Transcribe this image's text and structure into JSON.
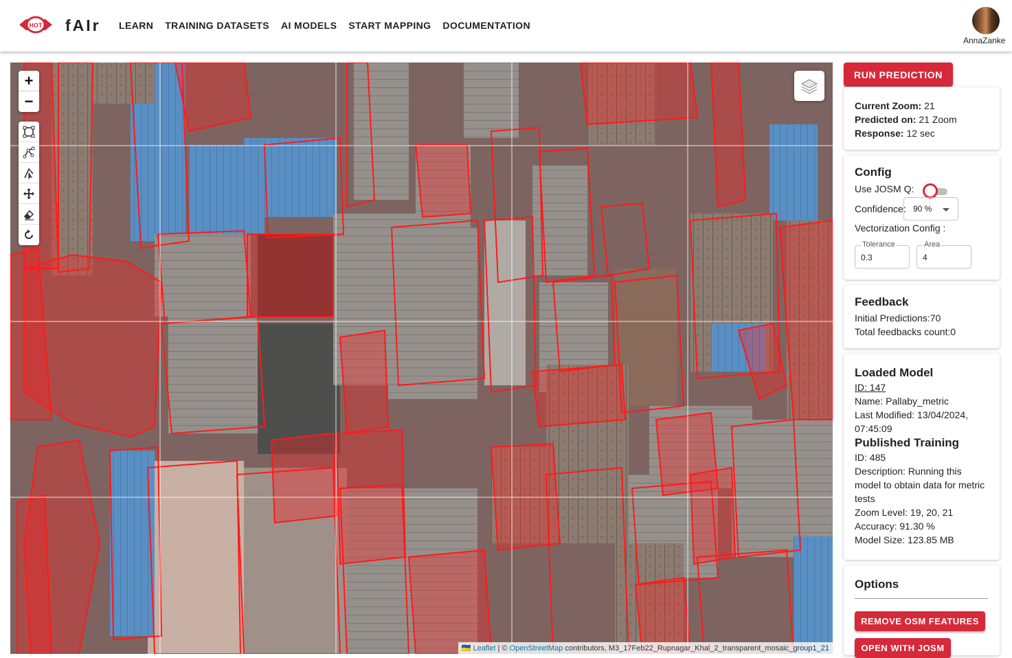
{
  "header": {
    "logo_text": "HOT",
    "brand": "fAIr",
    "nav": [
      "LEARN",
      "TRAINING DATASETS",
      "AI MODELS",
      "START MAPPING",
      "DOCUMENTATION"
    ],
    "username": "AnnaZanke"
  },
  "map": {
    "zoom_in": "+",
    "zoom_out": "−",
    "attribution": {
      "flag": "🇺🇦",
      "leaflet": "Leaflet",
      "sep": " | © ",
      "osm": "OpenStreetMap",
      "rest": " contributors, M3_17Feb22_Rupnagar_Khal_2_transparent_mosaic_group1_21"
    }
  },
  "sidebar": {
    "run_prediction": "RUN PREDICTION",
    "status": {
      "current_zoom_label": "Current Zoom:",
      "current_zoom_value": " 21",
      "predicted_on_label": "Predicted on:",
      "predicted_on_value": " 21 Zoom",
      "response_label": "Response:",
      "response_value": " 12 sec"
    },
    "config": {
      "title": "Config",
      "josm_label": "Use JOSM Q:",
      "confidence_label": "Confidence:",
      "confidence_value": "90 %",
      "vectorization_label": "Vectorization Config :",
      "tolerance_label": "Tolerance",
      "tolerance_value": "0.3",
      "area_label": "Area",
      "area_value": "4"
    },
    "feedback": {
      "title": "Feedback",
      "initial": "Initial Predictions:70",
      "total": "Total feedbacks count:0"
    },
    "model": {
      "title": "Loaded Model",
      "id": "ID: 147",
      "name": "Name: Pallaby_metric",
      "modified": "Last Modified: 13/04/2024, 07:45:09",
      "training_title": "Published Training",
      "training_id": "ID: 485",
      "description": "Description: Running this model to obtain data for metric tests",
      "zoom_level": "Zoom Level: 19, 20, 21",
      "accuracy": "Accuracy: 91.30 %",
      "size": "Model Size: 123.85 MB"
    },
    "options": {
      "title": "Options",
      "remove_osm": "REMOVE OSM FEATURES",
      "open_josm": "OPEN WITH JOSM"
    }
  },
  "colors": {
    "accent": "#d6293a",
    "prediction_outline": "#ff1a1a"
  }
}
